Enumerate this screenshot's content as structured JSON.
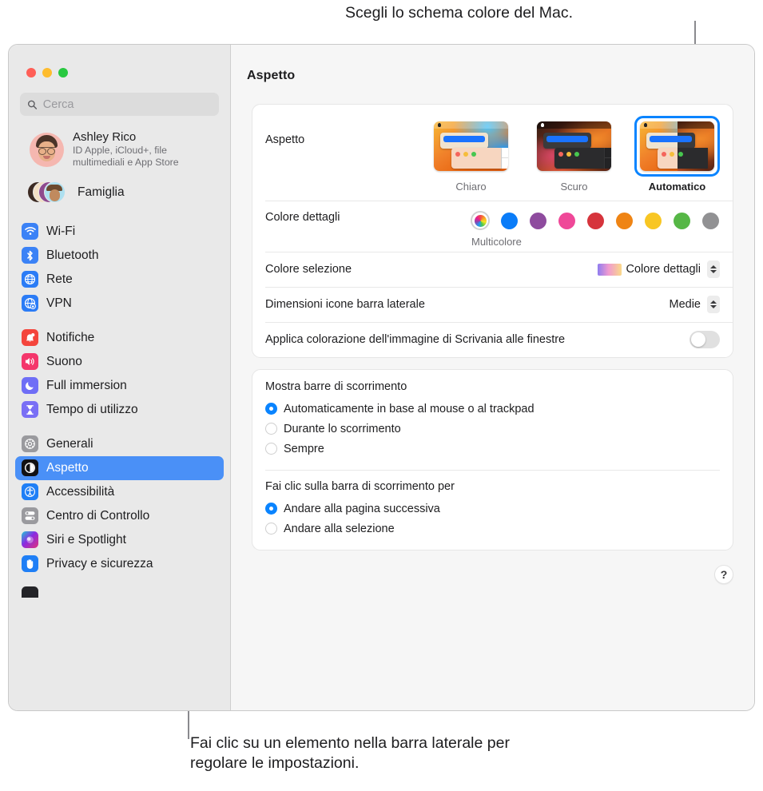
{
  "callouts": {
    "top": "Scegli lo schema colore del Mac.",
    "bottom": "Fai clic su un elemento nella barra laterale per regolare le impostazioni."
  },
  "window": {
    "title": "Aspetto"
  },
  "search": {
    "placeholder": "Cerca",
    "value": "",
    "icon": "search-icon"
  },
  "sidebar": {
    "account": {
      "name": "Ashley Rico",
      "subtitle": "ID Apple, iCloud+, file multimediali e App Store",
      "avatar_icon": "memoji-avatar"
    },
    "family": {
      "label": "Famiglia",
      "icon": "family-avatars-icon"
    },
    "groups": [
      {
        "items": [
          {
            "label": "Wi-Fi",
            "icon": "wifi-icon",
            "selected": false
          },
          {
            "label": "Bluetooth",
            "icon": "bluetooth-icon",
            "selected": false
          },
          {
            "label": "Rete",
            "icon": "network-globe-icon",
            "selected": false
          },
          {
            "label": "VPN",
            "icon": "vpn-globe-icon",
            "selected": false
          }
        ]
      },
      {
        "items": [
          {
            "label": "Notifiche",
            "icon": "bell-icon",
            "selected": false
          },
          {
            "label": "Suono",
            "icon": "speaker-icon",
            "selected": false
          },
          {
            "label": "Full immersion",
            "icon": "moon-icon",
            "selected": false
          },
          {
            "label": "Tempo di utilizzo",
            "icon": "hourglass-icon",
            "selected": false
          }
        ]
      },
      {
        "items": [
          {
            "label": "Generali",
            "icon": "gear-icon",
            "selected": false
          },
          {
            "label": "Aspetto",
            "icon": "appearance-icon",
            "selected": true
          },
          {
            "label": "Accessibilità",
            "icon": "accessibility-icon",
            "selected": false
          },
          {
            "label": "Centro di Controllo",
            "icon": "control-center-icon",
            "selected": false
          },
          {
            "label": "Siri e Spotlight",
            "icon": "siri-icon",
            "selected": false
          },
          {
            "label": "Privacy e sicurezza",
            "icon": "hand-privacy-icon",
            "selected": false
          }
        ]
      }
    ],
    "selected_accent": "#4a90f7"
  },
  "main": {
    "appearance": {
      "label": "Aspetto",
      "options": [
        {
          "name": "Chiaro",
          "selected": false
        },
        {
          "name": "Scuro",
          "selected": false
        },
        {
          "name": "Automatico",
          "selected": true
        }
      ]
    },
    "accent": {
      "label": "Colore dettagli",
      "selected_name": "Multicolore",
      "swatches": [
        {
          "name": "Multicolore",
          "color": "multicolor",
          "selected": true
        },
        {
          "name": "Blu",
          "color": "#0a7cf8",
          "selected": false
        },
        {
          "name": "Viola",
          "color": "#8e4b9e",
          "selected": false
        },
        {
          "name": "Rosa",
          "color": "#ef4898",
          "selected": false
        },
        {
          "name": "Rosso",
          "color": "#d6343c",
          "selected": false
        },
        {
          "name": "Arancione",
          "color": "#ef8414",
          "selected": false
        },
        {
          "name": "Giallo",
          "color": "#f8c623",
          "selected": false
        },
        {
          "name": "Verde",
          "color": "#56b746",
          "selected": false
        },
        {
          "name": "Grigio",
          "color": "#919193",
          "selected": false
        }
      ]
    },
    "highlight": {
      "label": "Colore selezione",
      "value": "Colore dettagli",
      "chip_icon": "gradient-swatch-icon",
      "stepper_icon": "chevron-updown-icon"
    },
    "sidebar_icon_size": {
      "label": "Dimensioni icone barra laterale",
      "value": "Medie",
      "stepper_icon": "chevron-updown-icon"
    },
    "wallpaper_tinting": {
      "label": "Applica colorazione dell'immagine di Scrivania alle finestre",
      "enabled": false
    },
    "show_scrollbars": {
      "title": "Mostra barre di scorrimento",
      "options": [
        {
          "label": "Automaticamente in base al mouse o al trackpad",
          "selected": true
        },
        {
          "label": "Durante lo scorrimento",
          "selected": false
        },
        {
          "label": "Sempre",
          "selected": false
        }
      ]
    },
    "click_scrollbar": {
      "title": "Fai clic sulla barra di scorrimento per",
      "options": [
        {
          "label": "Andare alla pagina successiva",
          "selected": true
        },
        {
          "label": "Andare alla selezione",
          "selected": false
        }
      ]
    },
    "help": {
      "label": "?",
      "icon": "help-icon"
    }
  }
}
